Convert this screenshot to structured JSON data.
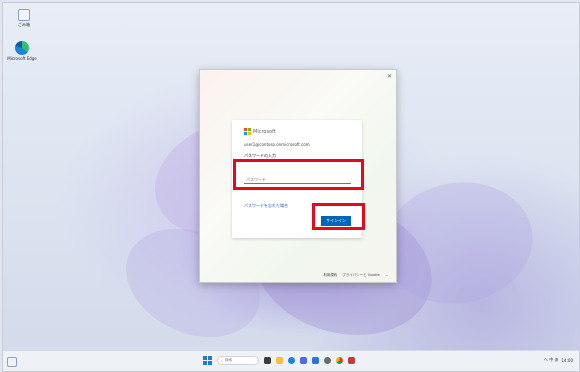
{
  "desktop": {
    "icons": [
      {
        "name": "Recycle Bin",
        "label": "ごみ箱"
      },
      {
        "name": "Microsoft Edge",
        "label": "Microsoft Edge"
      }
    ]
  },
  "dialog": {
    "brand": "Microsoft",
    "account_email": "user1@contoso.onmicrosoft.com",
    "heading": "パスワードの入力",
    "password_placeholder": "パスワード",
    "forgot_link": "パスワードを忘れた場合",
    "submit_label": "サインイン",
    "footer_links": [
      "利用規約",
      "プライバシーと Cookie",
      "..."
    ]
  },
  "taskbar": {
    "search_placeholder": "検索",
    "time": "14:00",
    "tray_text": "へ 中 あ"
  },
  "colors": {
    "highlight": "#e20a1b",
    "primary_button": "#0067b8"
  }
}
